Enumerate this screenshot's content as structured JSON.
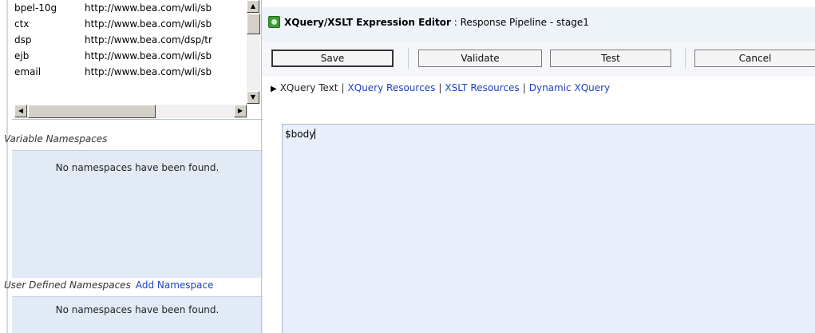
{
  "namespaces": {
    "rows": [
      {
        "prefix": "bpel-10g",
        "uri": "http://www.bea.com/wli/sb"
      },
      {
        "prefix": "ctx",
        "uri": "http://www.bea.com/wli/sb"
      },
      {
        "prefix": "dsp",
        "uri": "http://www.bea.com/dsp/tr"
      },
      {
        "prefix": "ejb",
        "uri": "http://www.bea.com/wli/sb"
      },
      {
        "prefix": "email",
        "uri": "http://www.bea.com/wli/sb"
      }
    ],
    "scroll_up_icon": "arrow-up-icon",
    "scroll_down_icon": "arrow-down-icon",
    "scroll_left_icon": "arrow-left-icon",
    "scroll_right_icon": "arrow-right-icon"
  },
  "variable_ns": {
    "heading": "Variable Namespaces",
    "empty": "No namespaces have been found."
  },
  "user_ns": {
    "heading": "User Defined Namespaces",
    "add_link": "Add Namespace",
    "empty": "No namespaces have been found."
  },
  "editor": {
    "title_bold": "XQuery/XSLT Expression Editor",
    "title_rest": " : Response Pipeline - stage1",
    "title_icon": "expression-editor-icon",
    "buttons": {
      "save": "Save",
      "validate": "Validate",
      "test": "Test",
      "cancel": "Cancel"
    },
    "tabs": {
      "current": "XQuery Text",
      "resources": "XQuery Resources",
      "xslt": "XSLT Resources",
      "dynamic": "Dynamic XQuery",
      "separator": "|"
    },
    "text": "$body"
  },
  "colors": {
    "link": "#1f3fc0",
    "section_bg": "#e2ebf5",
    "editor_bg": "#e8eefa",
    "title_bg": "#eef3f9"
  }
}
